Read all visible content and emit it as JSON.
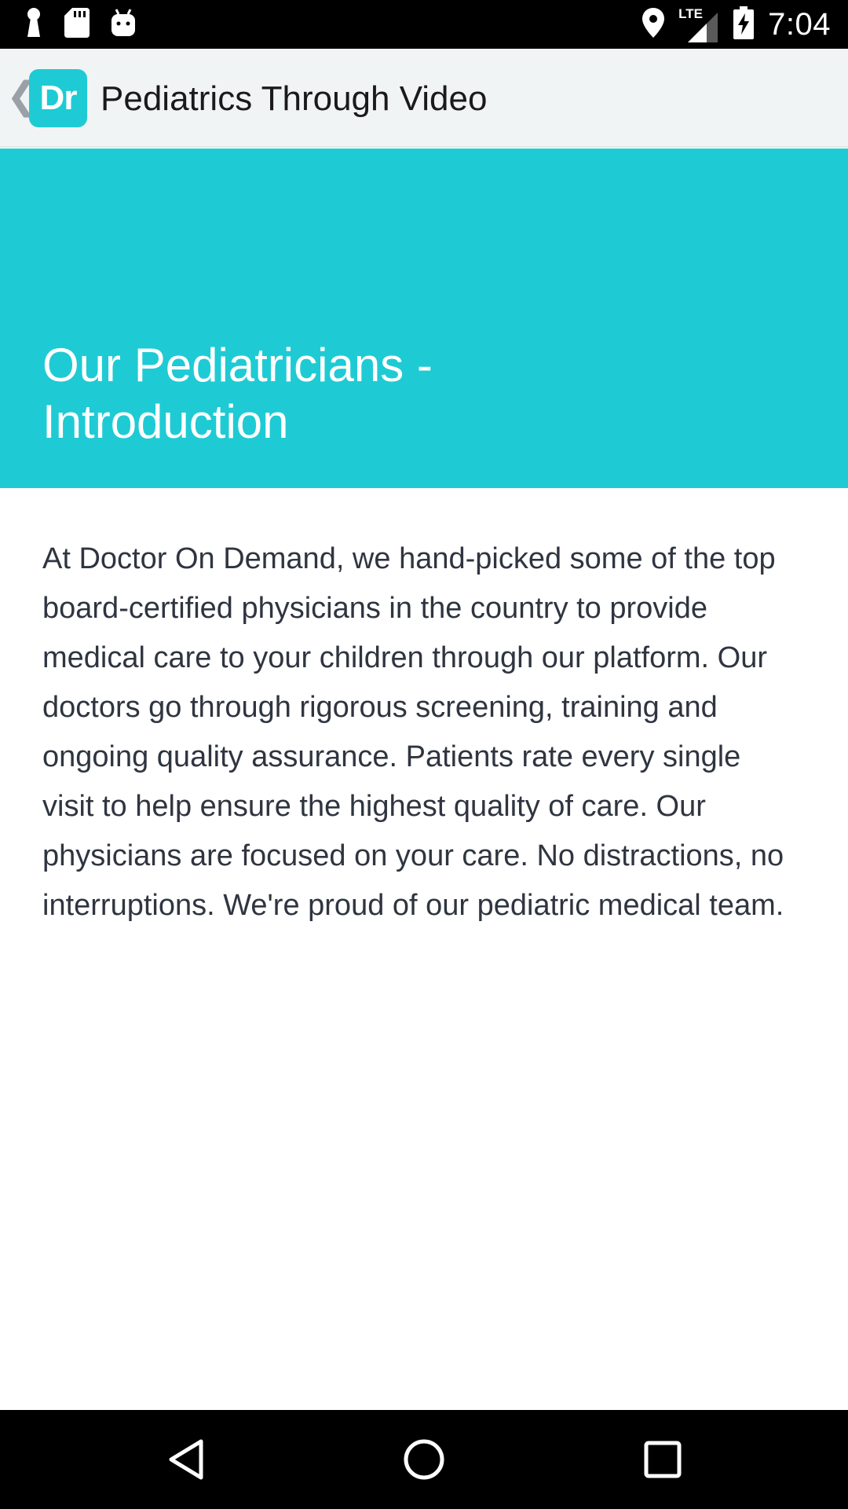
{
  "status_bar": {
    "time": "7:04",
    "network": "LTE",
    "left_icons": [
      "keyhole-icon",
      "sd-card-icon",
      "android-icon"
    ],
    "right_icons": [
      "location-icon",
      "signal-icon",
      "battery-charging-icon"
    ]
  },
  "app_bar": {
    "logo_text": "Dr",
    "title": "Pediatrics Through Video"
  },
  "hero": {
    "title": "Our Pediatricians - Introduction",
    "background_color": "#1ecbd4"
  },
  "content": {
    "body": "At Doctor On Demand, we hand-picked some of the top board-certified physicians in the country to provide medical care to your children through our platform. Our doctors go through rigorous screening, training and ongoing quality assurance. Patients rate every single visit to help ensure the highest quality of care. Our physicians are focused on your care. No distractions, no interruptions. We're proud of our pediatric medical team."
  },
  "nav_bar": {
    "buttons": [
      "back-triangle-icon",
      "home-circle-icon",
      "recents-square-icon"
    ]
  }
}
